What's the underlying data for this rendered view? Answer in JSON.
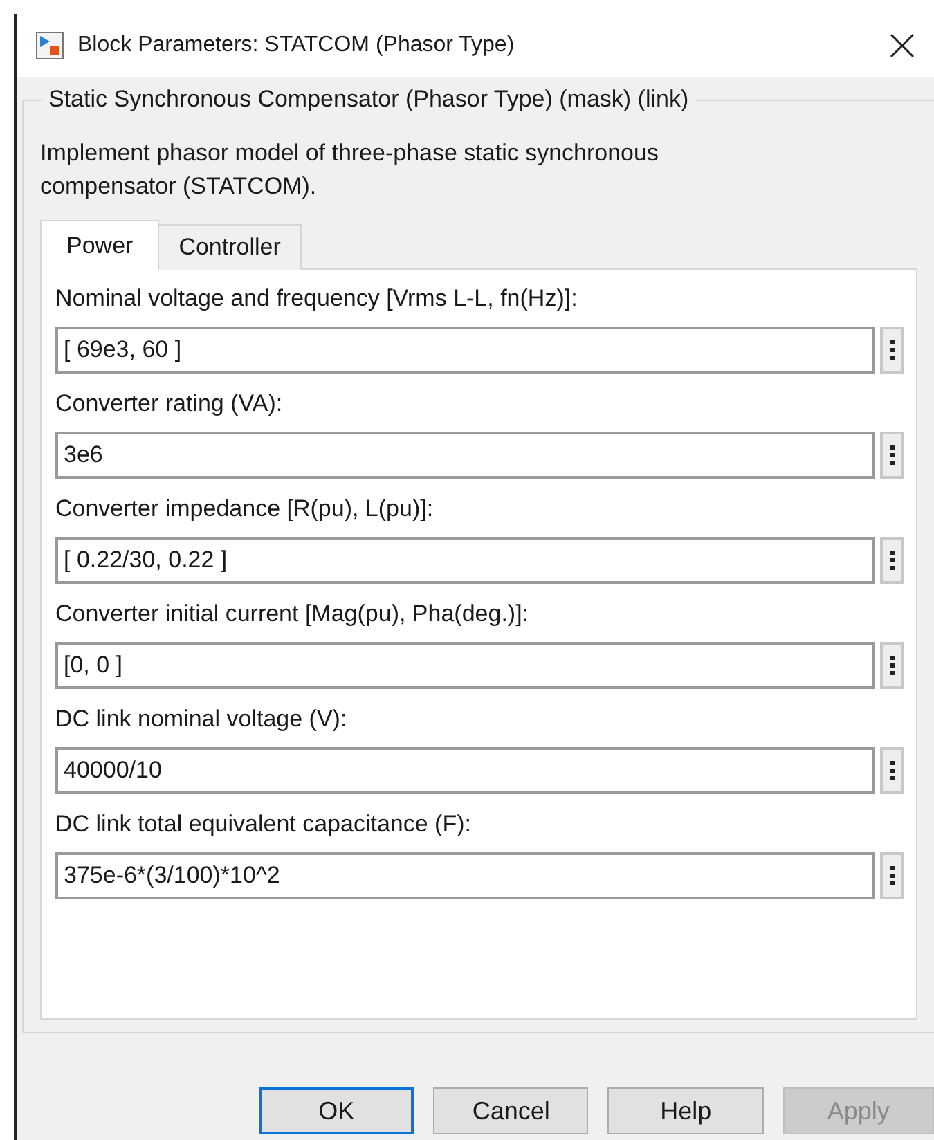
{
  "window": {
    "title": "Block Parameters: STATCOM (Phasor Type)"
  },
  "group": {
    "title": "Static Synchronous Compensator (Phasor Type) (mask) (link)",
    "description": "Implement phasor model of three-phase static synchronous compensator (STATCOM)."
  },
  "tabs": [
    {
      "label": "Power",
      "selected": true
    },
    {
      "label": "Controller",
      "selected": false
    }
  ],
  "parameters": [
    {
      "label": "Nominal voltage and frequency [Vrms L-L, fn(Hz)]:",
      "value": "[ 69e3, 60 ]"
    },
    {
      "label": "Converter rating (VA):",
      "value": "3e6"
    },
    {
      "label": "Converter impedance [R(pu), L(pu)]:",
      "value": "[ 0.22/30, 0.22 ]"
    },
    {
      "label": "Converter initial current [Mag(pu), Pha(deg.)]:",
      "value": "[0, 0 ]"
    },
    {
      "label": "DC link nominal voltage (V):",
      "value": "40000/10"
    },
    {
      "label": "DC link total equivalent capacitance (F):",
      "value": "375e-6*(3/100)*10^2"
    }
  ],
  "buttons": [
    {
      "label": "OK",
      "focused": true,
      "disabled": false
    },
    {
      "label": "Cancel",
      "focused": false,
      "disabled": false
    },
    {
      "label": "Help",
      "focused": false,
      "disabled": false
    },
    {
      "label": "Apply",
      "focused": false,
      "disabled": true
    }
  ]
}
